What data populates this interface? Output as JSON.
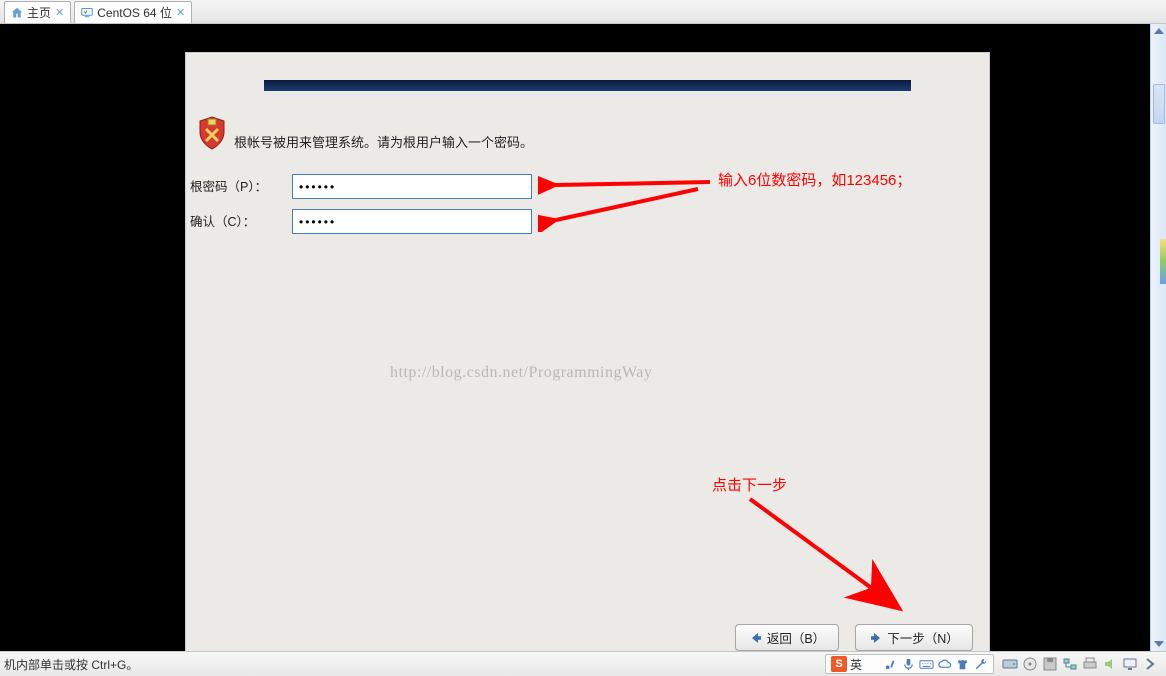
{
  "tabs": {
    "home": "主页",
    "vm": "CentOS 64 位"
  },
  "installer": {
    "instruction": "根帐号被用来管理系统。请为根用户输入一个密码。",
    "password_label": "根密码（P）：",
    "confirm_label": "确认（C）：",
    "password_value": "••••••",
    "confirm_value": "••••••",
    "watermark": "http://blog.csdn.net/ProgrammingWay",
    "back_label": "返回（B）",
    "next_label": "下一步（N）"
  },
  "annotations": {
    "hint1": "输入6位数密码，如123456；",
    "hint2": "点击下一步"
  },
  "status": {
    "hint": "机内部单击或按 Ctrl+G。",
    "ime_lang": "英"
  }
}
